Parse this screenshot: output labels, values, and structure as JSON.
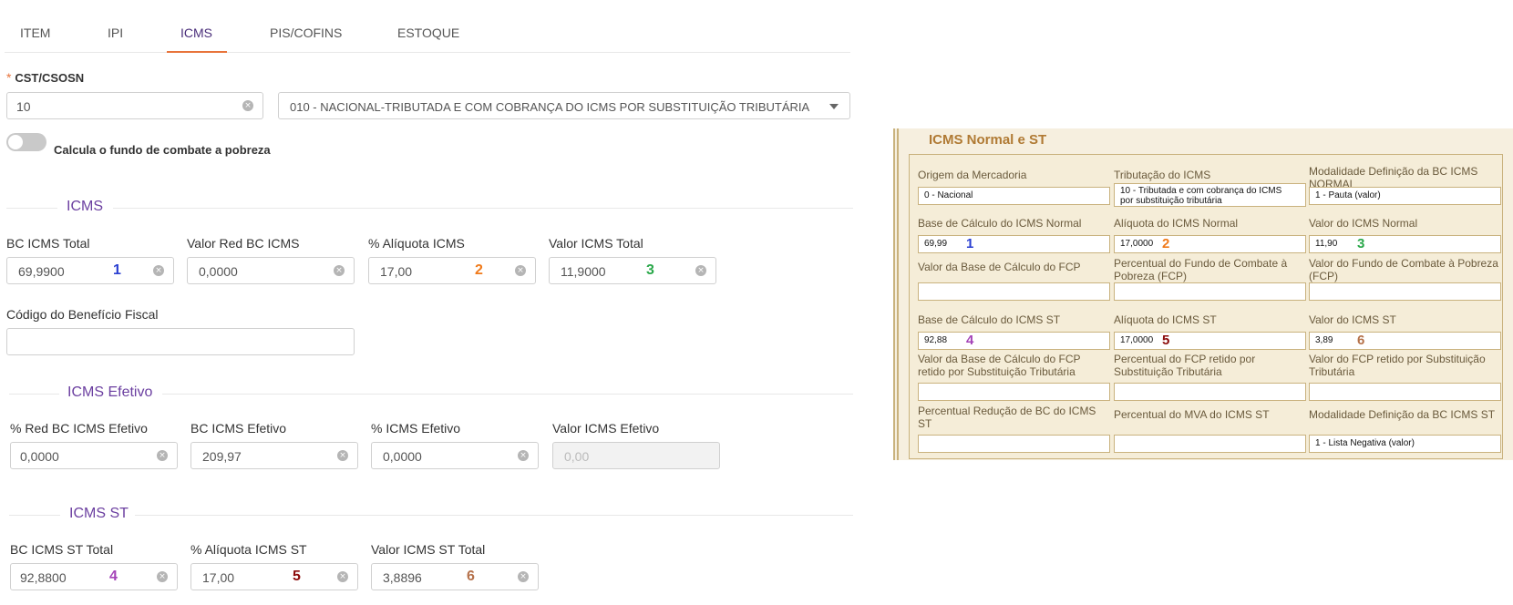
{
  "tabs": [
    "ITEM",
    "IPI",
    "ICMS",
    "PIS/COFINS",
    "ESTOQUE"
  ],
  "cst": {
    "required_mark": "*",
    "label": "CST/CSOSN",
    "code_value": "10",
    "description_value": "010 - NACIONAL-TRIBUTADA E COM COBRANÇA DO ICMS POR SUBSTITUIÇÃO TRIBUTÁRIA"
  },
  "toggle_label": "Calcula o fundo de combate a pobreza",
  "icms": {
    "title": "ICMS",
    "fields": [
      {
        "label": "BC ICMS Total",
        "value": "69,9900",
        "marker": "1"
      },
      {
        "label": "Valor Red BC ICMS",
        "value": "0,0000",
        "marker": ""
      },
      {
        "label": "% Alíquota ICMS",
        "value": "17,00",
        "marker": "2"
      },
      {
        "label": "Valor ICMS Total",
        "value": "11,9000",
        "marker": "3"
      }
    ],
    "beneficio_label": "Código do Benefício Fiscal",
    "beneficio_value": ""
  },
  "icms_efetivo": {
    "title": "ICMS Efetivo",
    "fields": [
      {
        "label": "% Red BC ICMS Efetivo",
        "value": "0,0000"
      },
      {
        "label": "BC ICMS Efetivo",
        "value": "209,97"
      },
      {
        "label": "% ICMS Efetivo",
        "value": "0,0000"
      },
      {
        "label": "Valor ICMS Efetivo",
        "value": "0,00"
      }
    ]
  },
  "icms_st": {
    "title": "ICMS ST",
    "fields": [
      {
        "label": "BC ICMS ST Total",
        "value": "92,8800",
        "marker": "4"
      },
      {
        "label": "% Alíquota ICMS ST",
        "value": "17,00",
        "marker": "5"
      },
      {
        "label": "Valor ICMS ST Total",
        "value": "3,8896",
        "marker": "6"
      }
    ]
  },
  "marker_colors": {
    "1": "#2a3fd1",
    "2": "#f07a1a",
    "3": "#2aa84a",
    "4": "#a443b8",
    "5": "#8b0a0a",
    "6": "#b5714a"
  },
  "legacy": {
    "title": "ICMS Normal e ST",
    "cells": [
      {
        "label": "Origem da Mercadoria",
        "value": "0 - Nacional",
        "marker": ""
      },
      {
        "label": "Tributação do ICMS",
        "value": "10 - Tributada e com cobrança do ICMS por substituição tributária",
        "marker": ""
      },
      {
        "label": "Modalidade Definição da BC ICMS NORMAL",
        "value": "1 - Pauta (valor)",
        "marker": ""
      },
      {
        "label": "Base de Cálculo do ICMS Normal",
        "value": "69,99",
        "marker": "1"
      },
      {
        "label": "Alíquota do ICMS Normal",
        "value": "17,0000",
        "marker": "2"
      },
      {
        "label": "Valor do ICMS Normal",
        "value": "11,90",
        "marker": "3"
      },
      {
        "label": "Valor da Base de Cálculo do FCP",
        "value": "",
        "marker": ""
      },
      {
        "label": "Percentual do Fundo de Combate à Pobreza (FCP)",
        "value": "",
        "marker": ""
      },
      {
        "label": "Valor do Fundo de Combate à Pobreza (FCP)",
        "value": "",
        "marker": ""
      },
      {
        "label": "Base de Cálculo do ICMS ST",
        "value": "92,88",
        "marker": "4"
      },
      {
        "label": "Alíquota do ICMS ST",
        "value": "17,0000",
        "marker": "5"
      },
      {
        "label": "Valor do ICMS ST",
        "value": "3,89",
        "marker": "6"
      },
      {
        "label": "Valor da Base de Cálculo do FCP retido por Substituição Tributária",
        "value": "",
        "marker": ""
      },
      {
        "label": "Percentual do FCP retido por Substituição Tributária",
        "value": "",
        "marker": ""
      },
      {
        "label": "Valor do FCP retido por Substituição Tributária",
        "value": "",
        "marker": ""
      },
      {
        "label": "Percentual Redução de BC do ICMS ST",
        "value": "",
        "marker": ""
      },
      {
        "label": "Percentual do MVA do ICMS ST",
        "value": "",
        "marker": ""
      },
      {
        "label": "Modalidade Definição da BC ICMS ST",
        "value": "1 - Lista Negativa (valor)",
        "marker": ""
      }
    ]
  }
}
